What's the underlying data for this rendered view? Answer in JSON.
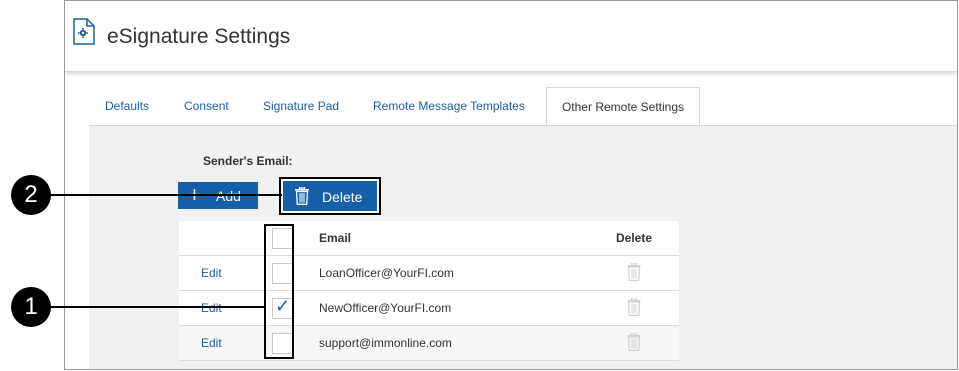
{
  "header": {
    "title": "eSignature Settings",
    "icon": "document-gear-icon"
  },
  "tabs": [
    {
      "label": "Defaults",
      "active": false
    },
    {
      "label": "Consent",
      "active": false
    },
    {
      "label": "Signature Pad",
      "active": false
    },
    {
      "label": "Remote Message Templates",
      "active": false
    },
    {
      "label": "Other Remote Settings",
      "active": true
    }
  ],
  "sender": {
    "label": "Sender's Email:",
    "add_label": "Add",
    "delete_label": "Delete"
  },
  "table": {
    "headers": {
      "email": "Email",
      "delete": "Delete"
    },
    "rows": [
      {
        "edit": "Edit",
        "checked": false,
        "email": "LoanOfficer@YourFI.com"
      },
      {
        "edit": "Edit",
        "checked": true,
        "email": "NewOfficer@YourFI.com"
      },
      {
        "edit": "Edit",
        "checked": false,
        "email": "support@immonline.com"
      }
    ]
  },
  "callouts": {
    "one": "1",
    "two": "2"
  },
  "colors": {
    "primary": "#1560a8",
    "link": "#1e5fa3",
    "panel": "#f1f1f1"
  }
}
